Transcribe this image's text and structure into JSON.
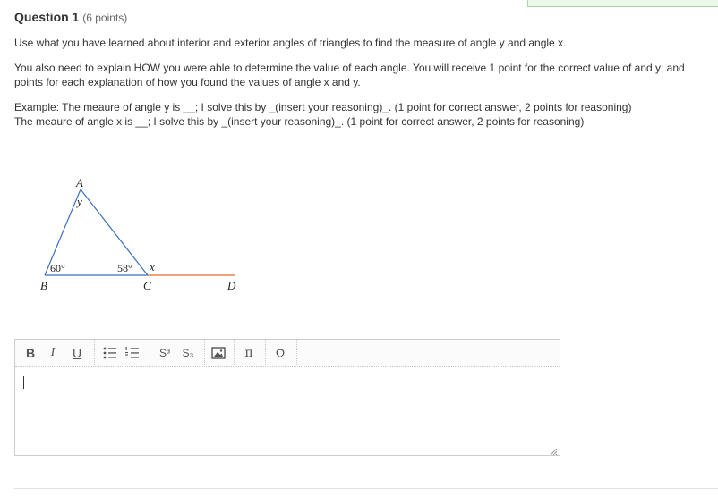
{
  "question": {
    "title": "Question 1",
    "points": "(6 points)"
  },
  "instructions": {
    "line1": "Use what you have learned about interior and exterior angles of triangles to find the measure of angle y and angle x.",
    "line2a": "You also need to explain HOW you were able to determine the value of each angle.  You will receive 1 point for the correct value of and y; and",
    "line2b": "points for each explanation of how you found the values of angle x and y.",
    "line3a": "Example:  The meaure of angle y is __; I solve this by _(insert your reasoning)_. (1 point for correct answer, 2 points for reasoning)",
    "line3b": "The meaure of angle x is __; I solve this by _(insert your reasoning)_. (1 point for correct answer, 2 points for reasoning)"
  },
  "figure": {
    "vertex_a": "A",
    "vertex_b": "B",
    "vertex_c": "C",
    "vertex_d": "D",
    "angle_y": "y",
    "angle_x": "x",
    "angle_b": "60°",
    "angle_c": "58°",
    "colors": {
      "triangle": "#3b6fc2",
      "extension": "#e06a2c",
      "labels": "#222222"
    }
  },
  "editor": {
    "toolbar": {
      "bold_label": "B",
      "italic_label": "I",
      "underline_label": "U",
      "superscript_label": "S³",
      "subscript_label": "S₃",
      "pi_label": "π",
      "omega_label": "Ω"
    },
    "content": ""
  }
}
